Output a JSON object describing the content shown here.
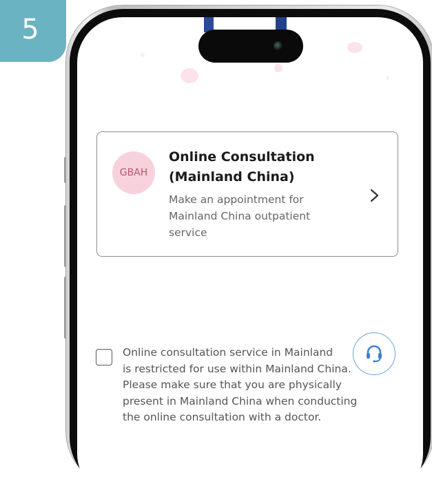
{
  "step": {
    "number": "5"
  },
  "theme": {
    "badge_color": "#6ab3c2",
    "logo_bg": "#f7d2dc",
    "logo_text_color": "#b8566f",
    "support_accent": "#3f7fd0"
  },
  "service_card": {
    "logo_text": "GBAH",
    "title_line1": "Online Consultation",
    "title_line2": "(Mainland China)",
    "desc_line1": "Make an appointment for",
    "desc_line2": "Mainland China outpatient",
    "desc_line3": "service",
    "icon": "chevron-right-icon"
  },
  "notice": {
    "line1": "Online consultation service in Mainland",
    "line2": "is restricted for use within Mainland China.",
    "line3": "Please make sure that you are physically",
    "line4": "present in Mainland China when conducting",
    "line5": "the online consultation with a doctor.",
    "checked": false
  },
  "support": {
    "icon": "headset-icon"
  }
}
